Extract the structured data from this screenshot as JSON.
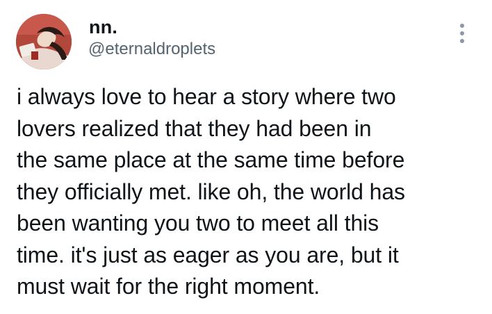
{
  "author": {
    "display_name": "nn.",
    "handle": "@eternaldroplets"
  },
  "icons": {
    "avatar": "profile-photo",
    "more": "more-options-vertical-dots-icon"
  },
  "tweet": {
    "text": "i always love to hear a story where two\nlovers realized that they had been in\nthe same place at the same time before\nthey officially met. like oh, the world has\nbeen wanting you two to meet all this\ntime. it's just as eager as you are, but it\nmust wait for the right moment."
  },
  "colors": {
    "text_primary": "#0f1419",
    "text_secondary": "#536471",
    "avatar_bg": "#b2473c"
  }
}
